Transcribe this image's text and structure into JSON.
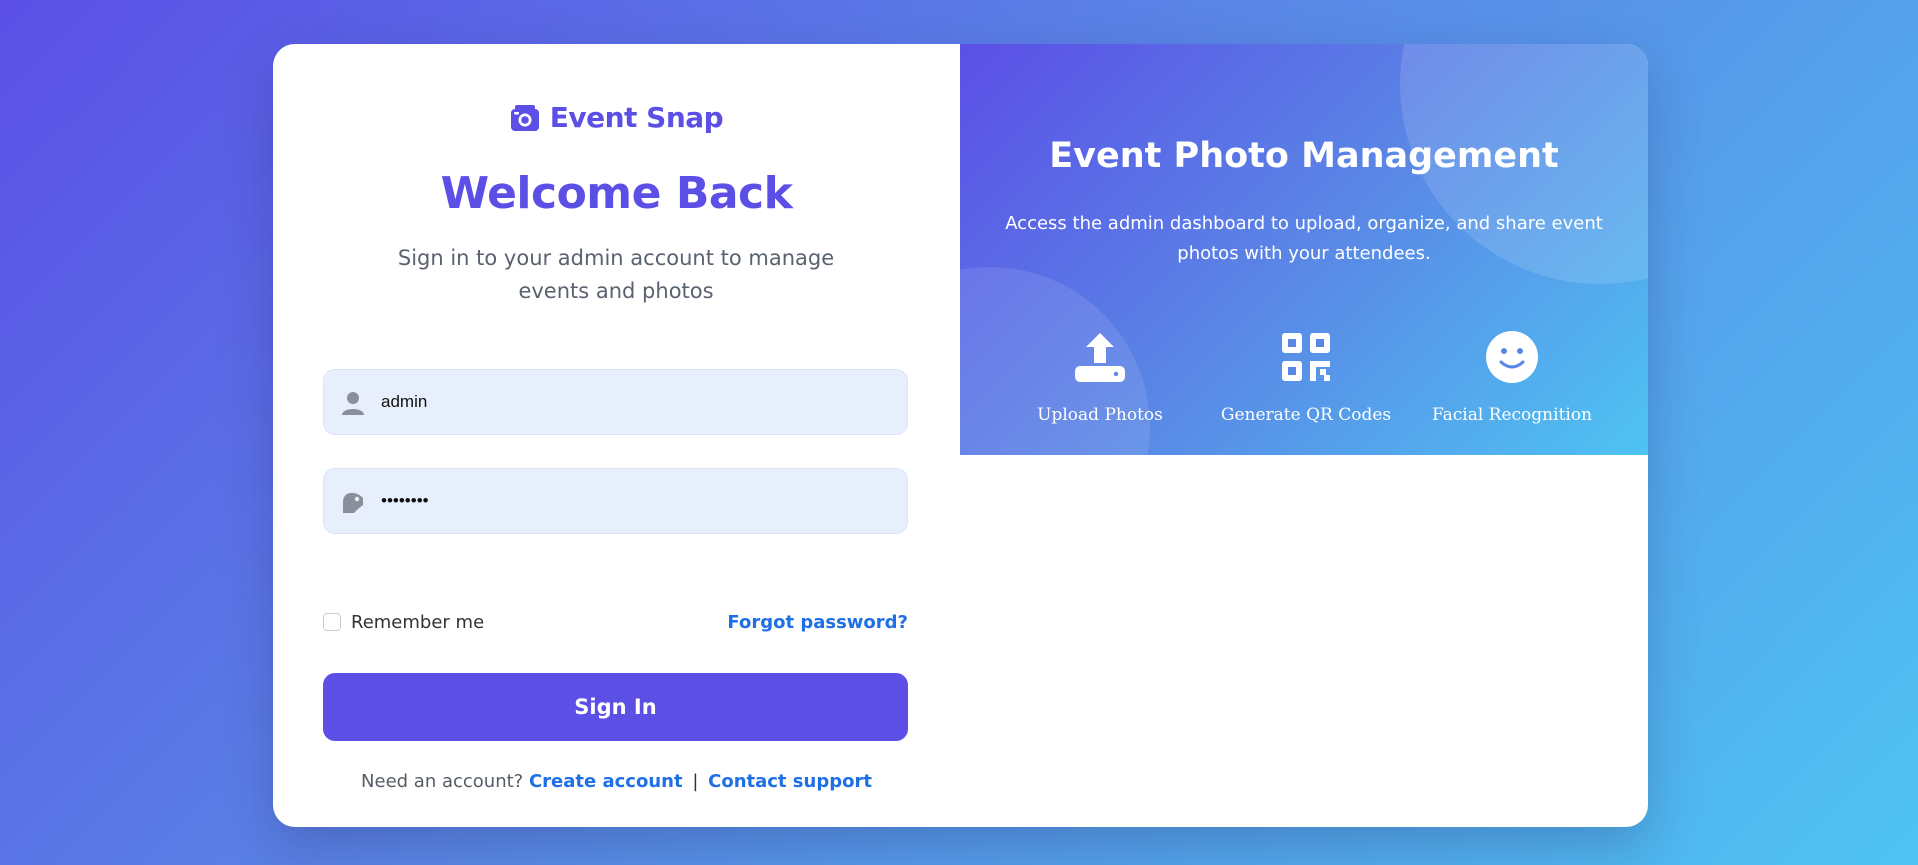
{
  "brand": {
    "name": "Event Snap",
    "color": "#5b4fe6"
  },
  "login": {
    "heading": "Welcome Back",
    "subtitle": "Sign in to your admin account to manage events and photos",
    "username": {
      "value": "admin",
      "icon": "user-icon"
    },
    "password": {
      "value": "••••••••",
      "icon": "key-icon"
    },
    "remember_label": "Remember me",
    "remember_checked": false,
    "forgot_label": "Forgot password?",
    "signin_label": "Sign In",
    "footer_prefix": "Need an account?",
    "create_account_label": "Create account",
    "separator": "|",
    "contact_support_label": "Contact support"
  },
  "promo": {
    "title": "Event Photo Management",
    "description": "Access the admin dashboard to upload, organize, and share event photos with your attendees.",
    "features": [
      {
        "label": "Upload Photos",
        "icon": "upload-icon"
      },
      {
        "label": "Generate QR Codes",
        "icon": "qr-code-icon"
      },
      {
        "label": "Facial Recognition",
        "icon": "smile-icon"
      }
    ]
  },
  "colors": {
    "accent": "#5b4fe6",
    "link": "#1f6fe6",
    "field_bg": "#e8effc"
  }
}
